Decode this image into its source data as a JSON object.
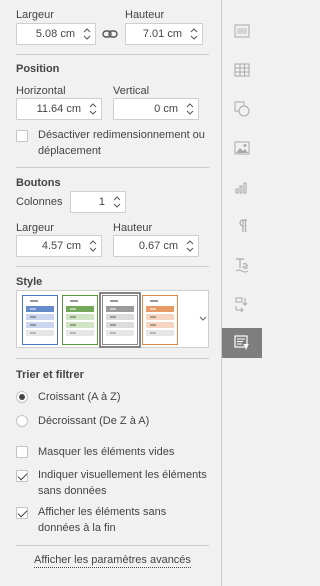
{
  "size": {
    "width_label": "Largeur",
    "height_label": "Hauteur",
    "width_value": "5.08 cm",
    "height_value": "7.01 cm"
  },
  "position": {
    "title": "Position",
    "horizontal_label": "Horizontal",
    "vertical_label": "Vertical",
    "horizontal_value": "11.64 cm",
    "vertical_value": "0 cm",
    "lock_label_line1": "Désactiver redimensionnement ou",
    "lock_label_line2": "déplacement"
  },
  "buttons": {
    "title": "Boutons",
    "columns_label": "Colonnes",
    "columns_value": "1",
    "width_label": "Largeur",
    "height_label": "Hauteur",
    "width_value": "4.57 cm",
    "height_value": "0.67 cm"
  },
  "style": {
    "title": "Style",
    "options": [
      {
        "accent": "#4a77c1",
        "light": "#c9d6ee"
      },
      {
        "accent": "#5a9a3c",
        "light": "#cfe5c3"
      },
      {
        "accent": "#8a8a8a",
        "light": "#dcdcdc"
      },
      {
        "accent": "#e2884a",
        "light": "#f6d6c2"
      }
    ],
    "selected_index": 2
  },
  "sort": {
    "title": "Trier et filtrer",
    "asc_label": "Croissant (A à Z)",
    "desc_label": "Décroissant (De Z à A)",
    "selected": "asc"
  },
  "options": {
    "hide_empty": "Masquer les éléments vides",
    "indicate_line1": "Indiquer visuellement les éléments",
    "indicate_line2": "sans données",
    "show_line1": "Afficher les éléments sans",
    "show_line2": "données à la fin"
  },
  "advanced_link": "Afficher les paramètres avancés",
  "colors": {
    "panel_bg": "#f1f1f1",
    "rail_active": "#7e7e7e",
    "icon": "#a9a9a9"
  }
}
